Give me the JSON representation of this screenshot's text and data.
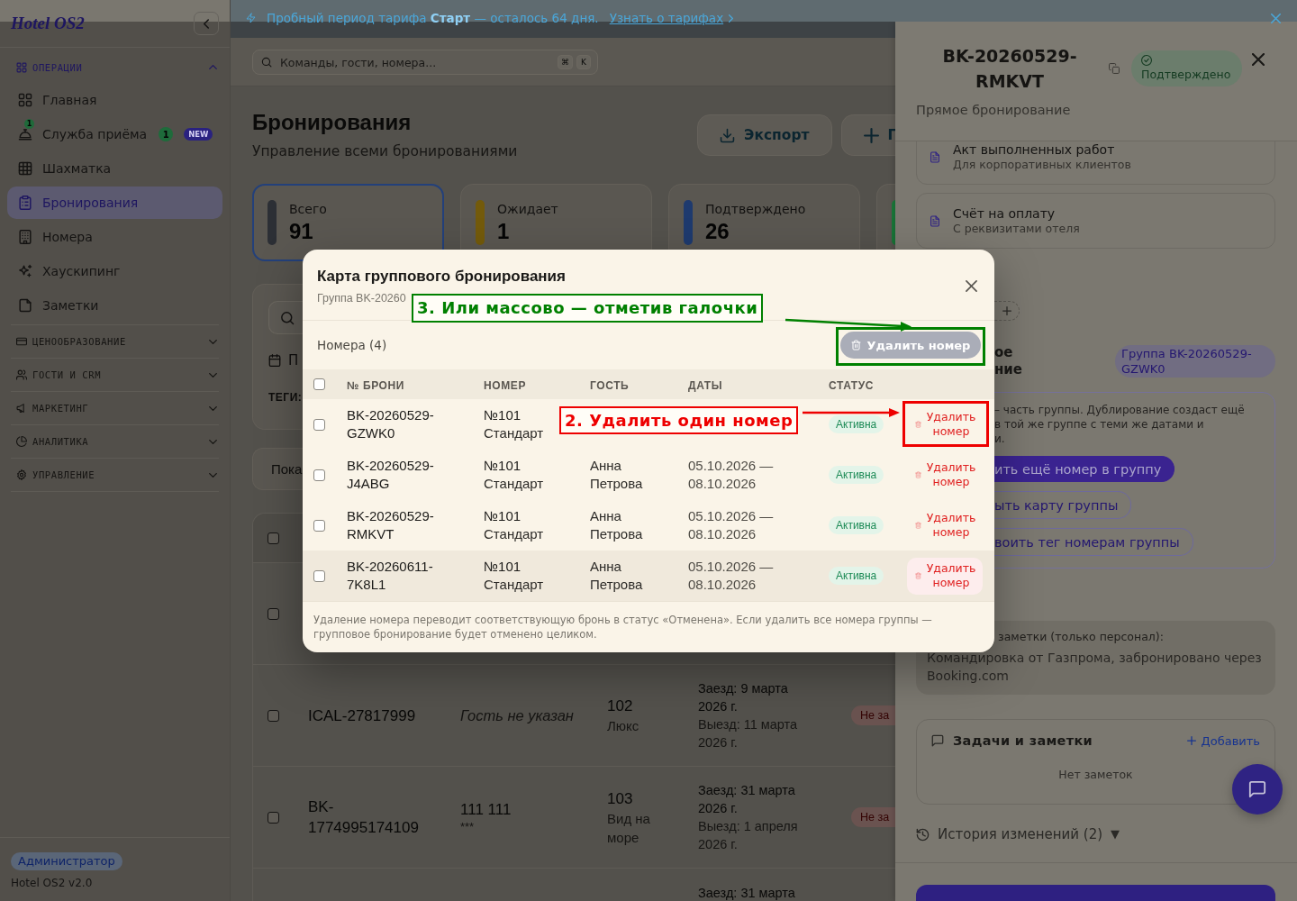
{
  "trial_banner": {
    "text": "Пробный период тарифа **Старт** — осталось 64 дня.",
    "link": "Узнать о тарифах"
  },
  "sidebar": {
    "logo": "Hotel OS2",
    "sections": [
      {
        "label": "ОПЕРАЦИИ",
        "expanded": true,
        "items": [
          {
            "label": "Главная",
            "selected": false
          },
          {
            "label": "Служба приёма",
            "selected": false,
            "icon_badge": "1",
            "count": "1",
            "tag": "NEW"
          },
          {
            "label": "Шахматка",
            "selected": false
          },
          {
            "label": "Бронирования",
            "selected": true
          },
          {
            "label": "Номера",
            "selected": false
          },
          {
            "label": "Хаускипинг",
            "selected": false
          },
          {
            "label": "Заметки",
            "selected": false
          }
        ]
      },
      {
        "label": "ЦЕНООБРАЗОВАНИЕ",
        "expanded": false
      },
      {
        "label": "ГОСТИ И CRM",
        "expanded": false
      },
      {
        "label": "МАРКЕТИНГ",
        "expanded": false
      },
      {
        "label": "АНАЛИТИКА",
        "expanded": false
      },
      {
        "label": "УПРАВЛЕНИЕ",
        "expanded": false
      }
    ],
    "role": "Администратор",
    "version": "Hotel OS2 v2.0"
  },
  "search": {
    "placeholder": "Команды, гости, номера...",
    "shortcut": [
      "⌘",
      "K"
    ]
  },
  "page_header": {
    "title": "Бронирования",
    "subtitle": "Управление всеми бронированиями",
    "buttons": [
      {
        "kind": "export",
        "label": "Экспорт"
      },
      {
        "kind": "create",
        "label": "Г"
      }
    ]
  },
  "stats": [
    {
      "label": "Всего",
      "value": "91",
      "selected": true,
      "color": "#2c2f35"
    },
    {
      "label": "Ожидает",
      "value": "1",
      "selected": false,
      "color": "#735a0b"
    },
    {
      "label": "Подтверждено",
      "value": "26",
      "selected": false,
      "color": "#1e3a6e"
    },
    {
      "selected": false,
      "color": "#1a7a3a"
    }
  ],
  "filters": {
    "date_label": "П",
    "tags_label": "ТЕГИ:"
  },
  "results_bar": {
    "text": "Пока"
  },
  "bookings_table": {
    "select_all": false,
    "rows": [
      {
        "checked": false
      },
      {
        "checked": false,
        "booking": "ICAL-27817999",
        "guest": "Гость не указан",
        "guest_known": false,
        "room": "102",
        "room_type": "Люкс",
        "check_in": "Заезд: 9 марта 2026 г.",
        "check_out": "Выезд: 11 марта 2026 г.",
        "status": "Не за"
      },
      {
        "checked": false,
        "booking": "BK-1774995174109",
        "guest": "111 111",
        "guest_known": true,
        "guest_note": "***",
        "room": "103",
        "room_type": "Вид на море",
        "check_in": "Заезд: 31 марта 2026 г.",
        "check_out": "Выезд: 1 апреля 2026 г.",
        "status": "Не за"
      }
    ],
    "partial_row": {
      "check_in": "Заезд: 31 марта"
    }
  },
  "booking_drawer": {
    "title": "BK-20260529-RMKVT",
    "status": {
      "label": "Подтверждено",
      "kind": "confirmed"
    },
    "subtitle": "Прямое бронирование",
    "documents": [
      {
        "title": "Акт выполненных работ",
        "subtitle": "Для корпоративных клиентов"
      },
      {
        "title": "Счёт на оплату",
        "subtitle": "С реквизитами отеля"
      }
    ],
    "group": {
      "heading_lines": [
        "ое",
        "ние"
      ],
      "badge": "Группа BK-20260529-GZWK0",
      "info_lines": [
        "– часть группы. Дублирование создаст ещё",
        "в той же группе с теми же датами и",
        "и."
      ],
      "actions": [
        {
          "label": "ить ещё номер в группу",
          "primary": true
        },
        {
          "label": "ыть карту группы",
          "primary": false
        },
        {
          "label": "воить тег номерам группы",
          "primary": false
        }
      ]
    },
    "staff_notes": {
      "label": "заметки (только персонал):",
      "text": "Командировка от Газпрома, забронировано через Booking.com"
    },
    "tasks": {
      "title": "Задачи и заметки",
      "add": "Добавить",
      "empty": "Нет заметок"
    },
    "history": {
      "label": "История изменений (2)",
      "toggle": "▼"
    }
  },
  "group_modal": {
    "title": "Карта группового бронирования",
    "subtitle": "Группа BK-20260",
    "rooms_label": "Номера (4)",
    "bulk_delete": {
      "label": "Удалить номер",
      "disabled": true
    },
    "select_all": false,
    "columns": [
      "№ БРОНИ",
      "НОМЕР",
      "ГОСТЬ",
      "ДАТЫ",
      "СТАТУС"
    ],
    "rows": [
      {
        "checked": false,
        "highlighted": false,
        "booking": "BK-20260529-GZWK0",
        "room": "№101",
        "room_type": "Стандарт",
        "status": "Активна",
        "delete": "Удалить номер"
      },
      {
        "checked": false,
        "highlighted": false,
        "booking": "BK-20260529-J4ABG",
        "room": "№101",
        "room_type": "Стандарт",
        "guest": "Анна Петрова",
        "dates": "05.10.2026 — 08.10.2026",
        "status": "Активна",
        "delete": "Удалить номер"
      },
      {
        "checked": false,
        "highlighted": false,
        "booking": "BK-20260529-RMKVT",
        "room": "№101",
        "room_type": "Стандарт",
        "guest": "Анна Петрова",
        "dates": "05.10.2026 — 08.10.2026",
        "status": "Активна",
        "delete": "Удалить номер"
      },
      {
        "checked": false,
        "highlighted": true,
        "booking": "BK-20260611-7K8L1",
        "room": "№101",
        "room_type": "Стандарт",
        "guest": "Анна Петрова",
        "dates": "05.10.2026 — 08.10.2026",
        "status": "Активна",
        "delete": "Удалить номер"
      }
    ],
    "footnote": "Удаление номера переводит соответствующую бронь в статус «Отменена». Если удалить все номера группы — групповое бронирование будет отменено целиком."
  },
  "annotations": [
    {
      "text": "3. Или массово — отметив галочки",
      "color": "#008000"
    },
    {
      "text": "2. Удалить один номер",
      "color": "#ee0000"
    }
  ]
}
